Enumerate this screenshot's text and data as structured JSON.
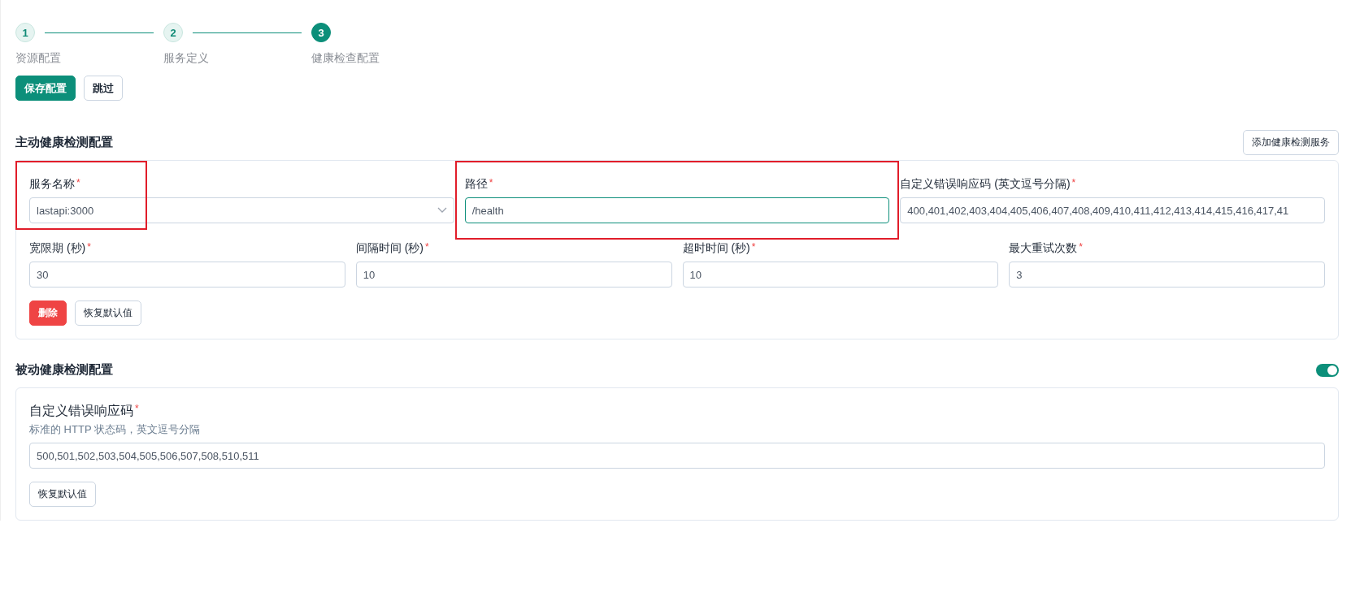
{
  "steps": [
    {
      "number": "1",
      "label": "资源配置",
      "selected": false
    },
    {
      "number": "2",
      "label": "服务定义",
      "selected": false
    },
    {
      "number": "3",
      "label": "健康检查配置",
      "selected": true
    }
  ],
  "top_buttons": [
    {
      "label": "保存配置",
      "kind": "primary"
    },
    {
      "label": "跳过",
      "kind": "default"
    }
  ],
  "active_check": {
    "title": "主动健康检测配置",
    "add_button": "添加健康检测服务",
    "target_fields": [
      {
        "label": "服务名称",
        "required_mark": "*",
        "kind": "select",
        "value": "lastapi:3000",
        "focused": false,
        "highlighted": true
      },
      {
        "label": "路径",
        "required_mark": "*",
        "kind": "text",
        "value": "/health",
        "focused": true,
        "highlighted": true
      },
      {
        "label": "自定义错误响应码 (英文逗号分隔)",
        "required_mark": "*",
        "kind": "text",
        "value": "400,401,402,403,404,405,406,407,408,409,410,411,412,413,414,415,416,417,41",
        "focused": false,
        "highlighted": false
      }
    ],
    "timing_fields": [
      {
        "label": "宽限期 (秒)",
        "required_mark": "*",
        "value": "30"
      },
      {
        "label": "间隔时间 (秒)",
        "required_mark": "*",
        "value": "10"
      },
      {
        "label": "超时时间 (秒)",
        "required_mark": "*",
        "value": "10"
      },
      {
        "label": "最大重试次数",
        "required_mark": "*",
        "value": "3"
      }
    ],
    "buttons": [
      {
        "label": "删除",
        "kind": "danger"
      },
      {
        "label": "恢复默认值",
        "kind": "default"
      }
    ]
  },
  "passive_check": {
    "title": "被动健康检测配置",
    "enabled": true,
    "field": {
      "label": "自定义错误响应码",
      "required_mark": "*",
      "hint": "标准的 HTTP 状态码，英文逗号分隔",
      "value": "500,501,502,503,504,505,506,507,508,510,511"
    },
    "button": "恢复默认值"
  }
}
